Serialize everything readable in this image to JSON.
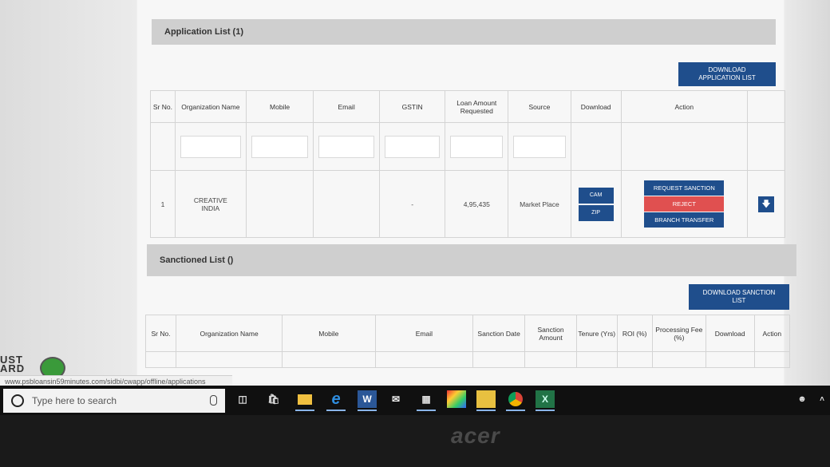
{
  "application_list": {
    "title": "Application List (1)",
    "download_label": "DOWNLOAD APPLICATION LIST",
    "columns": [
      "Sr No.",
      "Organization Name",
      "Mobile",
      "Email",
      "GSTIN",
      "Loan Amount Requested",
      "Source",
      "Download",
      "Action"
    ],
    "rows": [
      {
        "sr": "1",
        "org": "CREATIVE INDIA",
        "mobile": "",
        "email": "",
        "gstin": "-",
        "amount": "4,95,435",
        "source": "Market Place"
      }
    ],
    "download_buttons": {
      "cam": "CAM",
      "zip": "ZIP"
    },
    "action_buttons": {
      "request": "REQUEST SANCTION",
      "reject": "REJECT",
      "transfer": "BRANCH TRANSFER"
    }
  },
  "sanctioned_list": {
    "title": "Sanctioned List ()",
    "download_label": "DOWNLOAD SANCTION LIST",
    "columns": [
      "Sr No.",
      "Organization Name",
      "Mobile",
      "Email",
      "Sanction Date",
      "Sanction Amount",
      "Tenure (Yrs)",
      "ROI (%)",
      "Processing Fee (%)",
      "Download",
      "Action"
    ]
  },
  "status_url": "www.psbloansin59minutes.com/sidbi/cwapp/offline/applications",
  "logo_fragment": "UST ARD",
  "taskbar": {
    "search_placeholder": "Type here to search",
    "apps": [
      "task-view",
      "store",
      "file-explorer",
      "edge",
      "word",
      "mail",
      "calculator",
      "paint",
      "sticky-notes",
      "chrome",
      "excel"
    ]
  },
  "bezel_brand": "acer",
  "colors": {
    "button_blue": "#1f4e8c",
    "reject_red": "#e05050",
    "section_gray": "#cfcfcf"
  }
}
